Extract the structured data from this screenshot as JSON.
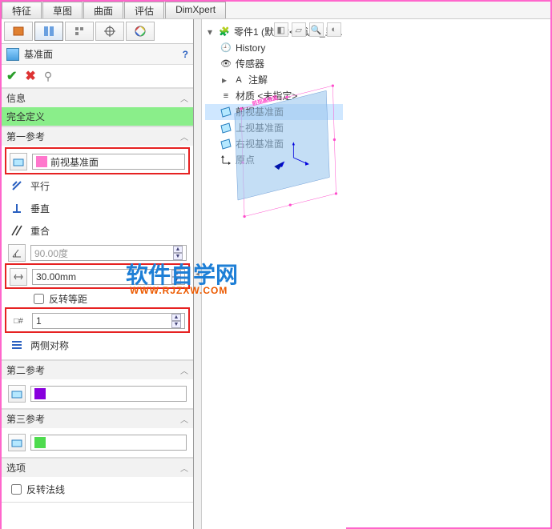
{
  "tabs": {
    "t0": "特征",
    "t1": "草图",
    "t2": "曲面",
    "t3": "评估",
    "t4": "DimXpert"
  },
  "feature": {
    "title": "基准面",
    "help_tip": "?",
    "ok": "✓",
    "cancel": "✕",
    "pin": "📌"
  },
  "info": {
    "hdr": "信息",
    "status": "完全定义"
  },
  "ref1": {
    "hdr": "第一参考",
    "selected": "前视基准面",
    "parallel": "平行",
    "perp": "垂直",
    "coincident": "重合",
    "angle": "90.00度",
    "distance": "30.00mm",
    "reverse": "反转等距",
    "instances": "1",
    "bothsides": "两侧对称"
  },
  "ref2": {
    "hdr": "第二参考",
    "selected": ""
  },
  "ref3": {
    "hdr": "第三参考",
    "selected": ""
  },
  "options": {
    "hdr": "选项",
    "flipnormal": "反转法线"
  },
  "tree": {
    "root": "零件1  (默认<<默认>_显...",
    "history": "History",
    "sensors": "传感器",
    "annotations": "注解",
    "material": "材质 <未指定>",
    "plane_front": "前视基准面",
    "plane_top": "上视基准面",
    "plane_right": "右视基准面",
    "origin": "原点"
  },
  "viewport": {
    "plane_label": "前视基准面"
  },
  "watermark": {
    "main": "软件自学网",
    "url": "WWW.RJZXW.COM"
  }
}
